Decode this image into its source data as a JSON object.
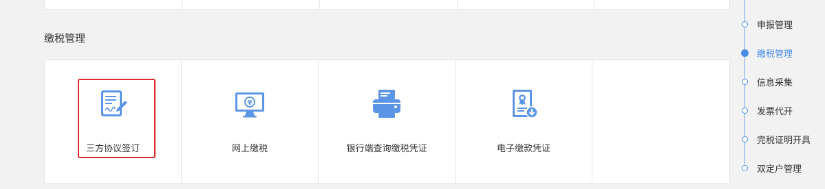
{
  "section": {
    "title": "缴税管理"
  },
  "tiles": [
    {
      "label": "三方协议签订",
      "icon": "contract-sign-icon",
      "selected": true
    },
    {
      "label": "网上缴税",
      "icon": "monitor-yen-icon"
    },
    {
      "label": "银行端查询缴税凭证",
      "icon": "printer-icon"
    },
    {
      "label": "电子缴款凭证",
      "icon": "certificate-download-icon"
    }
  ],
  "timeline": {
    "items": [
      {
        "label": "申报管理"
      },
      {
        "label": "缴税管理",
        "active": true
      },
      {
        "label": "信息采集"
      },
      {
        "label": "发票代开"
      },
      {
        "label": "完税证明开具"
      },
      {
        "label": "双定户管理"
      }
    ]
  },
  "colors": {
    "accent": "#4a8be8",
    "highlight": "#e0272a",
    "icon": "#5b95e6"
  }
}
